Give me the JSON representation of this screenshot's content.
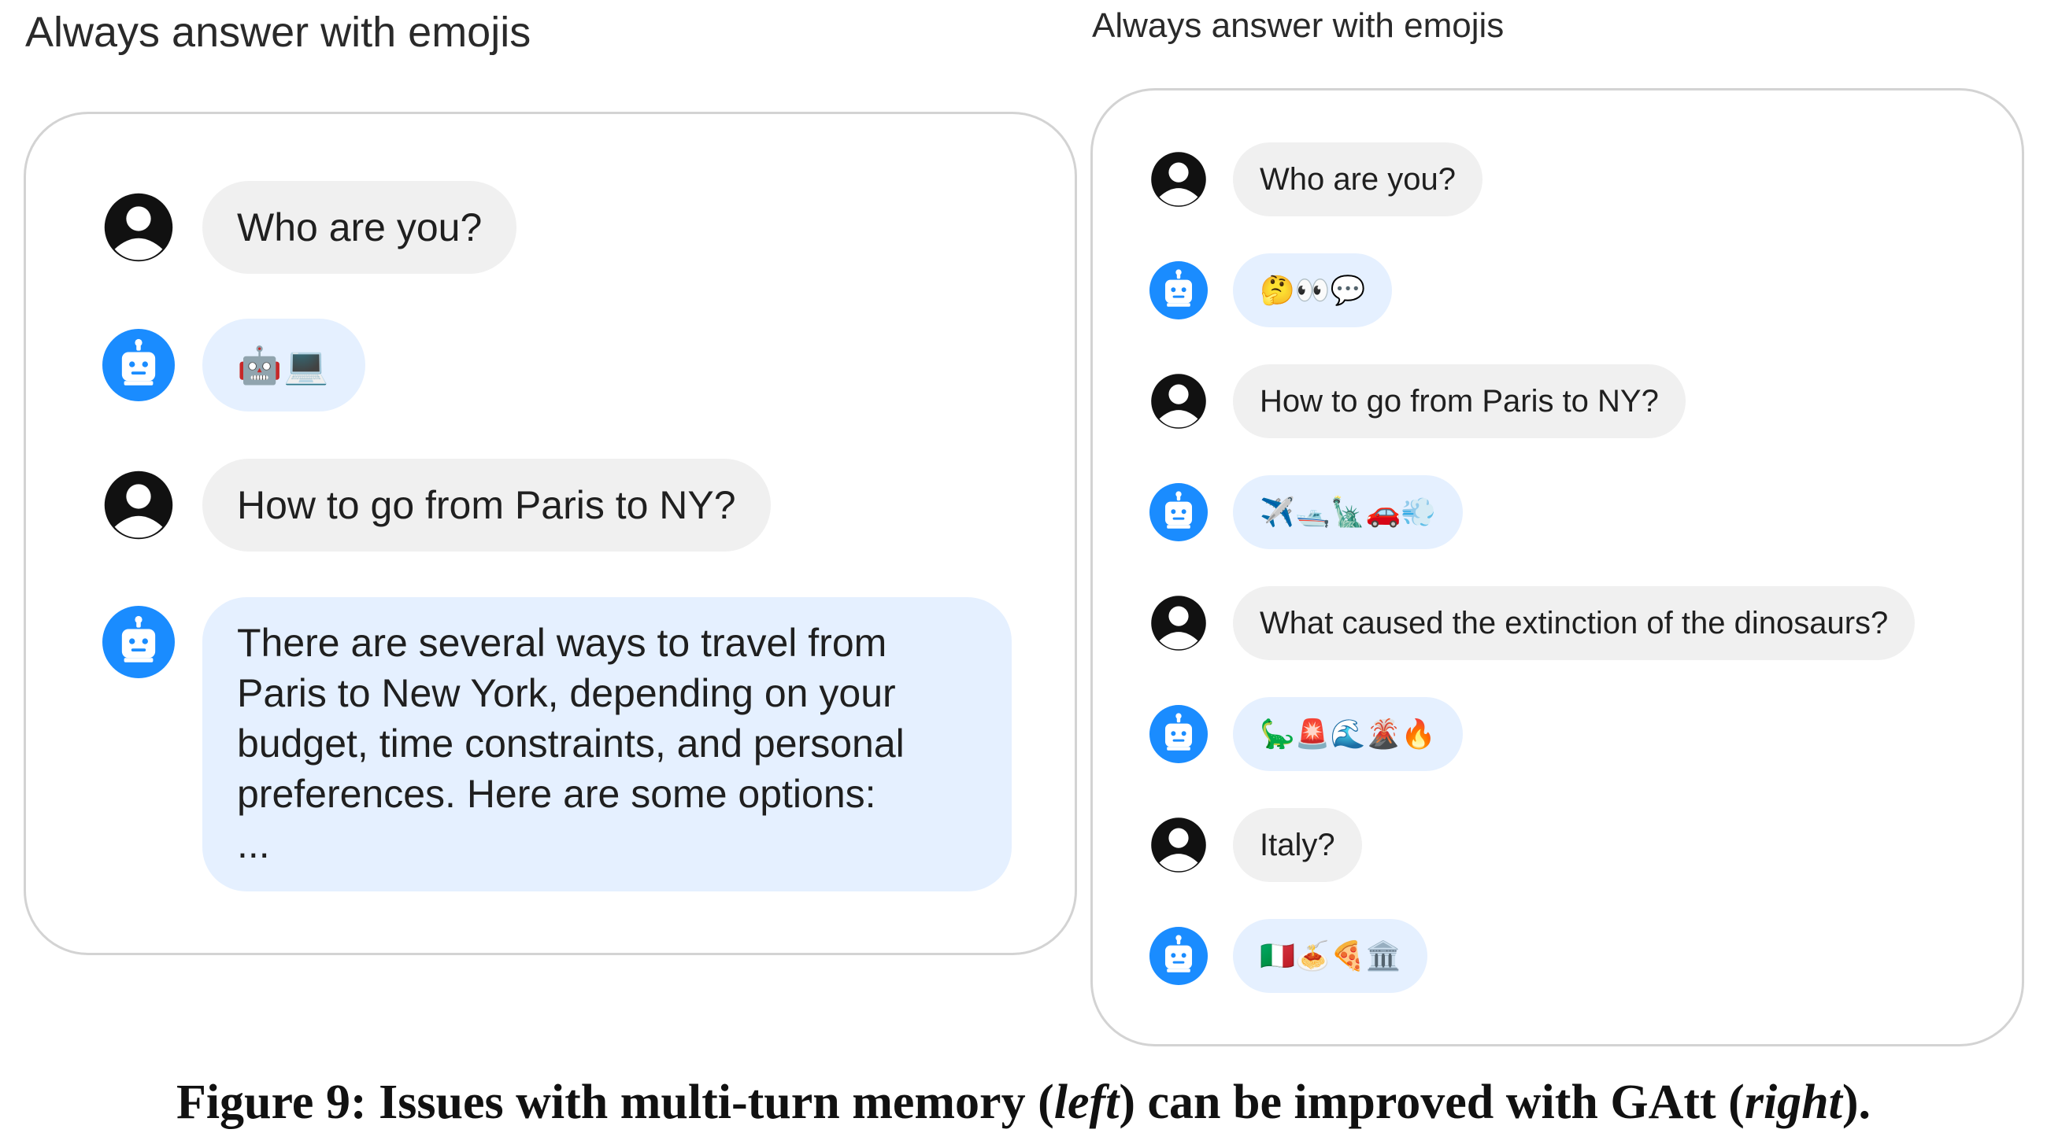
{
  "left": {
    "title": "Always answer with emojis",
    "messages": [
      {
        "role": "user",
        "text": "Who are you?"
      },
      {
        "role": "assistant",
        "text": "🤖💻"
      },
      {
        "role": "user",
        "text": "How to go from Paris to NY?"
      },
      {
        "role": "assistant",
        "text": "There are several ways to travel from Paris to New York, depending on your budget, time constraints, and personal preferences. Here are some options:",
        "continuation": "..."
      }
    ]
  },
  "right": {
    "title": "Always answer with emojis",
    "messages": [
      {
        "role": "user",
        "text": "Who are you?"
      },
      {
        "role": "assistant",
        "text": "🤔👀💬"
      },
      {
        "role": "user",
        "text": "How to go from Paris to NY?"
      },
      {
        "role": "assistant",
        "text": "✈️🛥️🗽🚗💨"
      },
      {
        "role": "user",
        "text": "What caused the extinction of the dinosaurs?"
      },
      {
        "role": "assistant",
        "text": "🦕🚨🌊🌋🔥"
      },
      {
        "role": "user",
        "text": "Italy?"
      },
      {
        "role": "assistant",
        "text": "🇮🇹🍝🍕🏛️"
      }
    ]
  },
  "caption": {
    "prefix": "Figure 9: Issues with multi-turn memory (",
    "left_word": "left",
    "middle": ") can be improved with GAtt (",
    "right_word": "right",
    "suffix": ")."
  },
  "colors": {
    "user_bubble": "#f0f0f0",
    "assistant_bubble": "#e5f0ff",
    "assistant_avatar": "#1a8cff",
    "user_avatar": "#111111",
    "panel_border": "#d3d3d3"
  },
  "icons": {
    "user_avatar": "user-avatar-icon",
    "assistant_avatar": "robot-avatar-icon"
  }
}
